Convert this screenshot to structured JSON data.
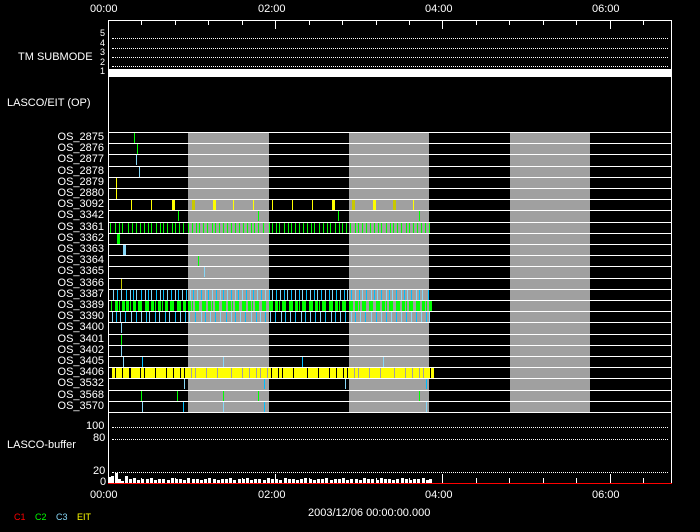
{
  "chart_data": {
    "type": "timeline",
    "date_label": "2003/12/06 00:00:00.000",
    "x_axis": {
      "unit": "hours",
      "range": [
        0,
        6.73
      ],
      "tick_labels": [
        "00:00",
        "02:00",
        "04:00",
        "06:00"
      ],
      "tick_values": [
        0,
        2,
        4,
        6
      ],
      "minor_step": 0.4
    },
    "tm_submode": {
      "label": "TM SUBMODE",
      "levels": [
        "5",
        "4",
        "3",
        "2",
        "1"
      ],
      "value": 1
    },
    "lasco_eit_label": "LASCO/EIT (OP)",
    "shaded_intervals": [
      [
        0.96,
        1.92
      ],
      [
        2.88,
        3.84
      ],
      [
        4.81,
        5.77
      ]
    ],
    "colors": {
      "C1": "#ff0000",
      "C2": "#00ff00",
      "C3": "#87d7f7",
      "CY": "#00bfff",
      "EIT": "#ffff00",
      "OL": "#c8c800"
    },
    "legend": [
      {
        "label": "C1",
        "color": "C1"
      },
      {
        "label": "C2",
        "color": "C2"
      },
      {
        "label": "C3",
        "color": "C3"
      },
      {
        "label": "EIT",
        "color": "EIT"
      }
    ],
    "rows": [
      {
        "label": "OS_2875",
        "marks": [
          {
            "c": "C2",
            "t": [
              0.31
            ]
          }
        ]
      },
      {
        "label": "OS_2876",
        "marks": [
          {
            "c": "C2",
            "t": [
              0.35
            ]
          }
        ]
      },
      {
        "label": "OS_2877",
        "marks": [
          {
            "c": "C3",
            "t": [
              0.33
            ]
          }
        ]
      },
      {
        "label": "OS_2878",
        "marks": [
          {
            "c": "C3",
            "t": [
              0.37
            ]
          }
        ]
      },
      {
        "label": "OS_2879",
        "marks": [
          {
            "c": "EIT",
            "t": [
              0.09
            ]
          }
        ]
      },
      {
        "label": "OS_2880",
        "marks": [
          {
            "c": "EIT",
            "t": [
              0.1
            ]
          }
        ]
      },
      {
        "label": "OS_3092",
        "marks": [
          {
            "c": "EIT",
            "t": [
              0.28,
              0.52,
              1.01,
              1.25,
              1.49,
              1.73,
              1.96,
              2.2,
              2.44,
              2.92,
              3.41,
              3.65
            ]
          },
          {
            "c": "EIT",
            "thick": true,
            "t": [
              0.77,
              1.25,
              2.68,
              3.17
            ]
          },
          {
            "c": "OL",
            "thick": true,
            "t": [
              1.01,
              2.92,
              3.41
            ]
          }
        ]
      },
      {
        "label": "OS_3342",
        "marks": [
          {
            "c": "C2",
            "t": [
              0.84,
              1.8,
              2.75,
              3.72
            ]
          }
        ]
      },
      {
        "label": "OS_3361",
        "marks": [
          {
            "c": "C2",
            "t": [
              0.02,
              0.08,
              0.13,
              0.17,
              0.24,
              0.29,
              0.34,
              0.38,
              0.43,
              0.48,
              0.52,
              0.57,
              0.62,
              0.66,
              0.71,
              0.76,
              0.8,
              0.85,
              0.9,
              0.96,
              1.0,
              1.05,
              1.09,
              1.14,
              1.19,
              1.24,
              1.28,
              1.33,
              1.38,
              1.42,
              1.47,
              1.52,
              1.57,
              1.61,
              1.66,
              1.71,
              1.75,
              1.8,
              1.85,
              1.92,
              1.96,
              2.01,
              2.05,
              2.1,
              2.15,
              2.19,
              2.24,
              2.29,
              2.33,
              2.38,
              2.43,
              2.47,
              2.52,
              2.57,
              2.62,
              2.66,
              2.71,
              2.76,
              2.8,
              2.85,
              2.9,
              2.95,
              2.99,
              3.04,
              3.09,
              3.13,
              3.18,
              3.23,
              3.27,
              3.32,
              3.37,
              3.41,
              3.46,
              3.51,
              3.56,
              3.6,
              3.65,
              3.7,
              3.74,
              3.79,
              3.84
            ]
          }
        ]
      },
      {
        "label": "OS_3362",
        "marks": [
          {
            "c": "C2",
            "thick": true,
            "t": [
              0.11
            ]
          }
        ]
      },
      {
        "label": "OS_3363",
        "marks": [
          {
            "c": "C3",
            "thick": true,
            "t": [
              0.18
            ]
          }
        ]
      },
      {
        "label": "OS_3364",
        "marks": [
          {
            "c": "C2",
            "t": [
              1.08
            ]
          }
        ]
      },
      {
        "label": "OS_3365",
        "marks": [
          {
            "c": "C3",
            "t": [
              1.15
            ]
          }
        ]
      },
      {
        "label": "OS_3366",
        "marks": [
          {
            "c": "OL",
            "t": [
              0.16
            ]
          }
        ]
      },
      {
        "label": "OS_3387",
        "marks": [
          {
            "c": "C3",
            "t": [
              0.06,
              0.16,
              0.26,
              0.34,
              0.44,
              0.52,
              0.62,
              0.7,
              0.8,
              0.88,
              0.98,
              1.06,
              1.16,
              1.24,
              1.34,
              1.42,
              1.52,
              1.6,
              1.7,
              1.78,
              1.88,
              1.96,
              2.06,
              2.14,
              2.24,
              2.32,
              2.42,
              2.5,
              2.6,
              2.68,
              2.78,
              2.86,
              2.96,
              3.04,
              3.14,
              3.22,
              3.32,
              3.4,
              3.5,
              3.58,
              3.68,
              3.76
            ]
          },
          {
            "c": "CY",
            "t": [
              0.11,
              0.21,
              0.3,
              0.39,
              0.48,
              0.57,
              0.66,
              0.75,
              0.84,
              0.93,
              1.02,
              1.11,
              1.2,
              1.29,
              1.38,
              1.47,
              1.56,
              1.65,
              1.74,
              1.83,
              1.92,
              2.01,
              2.1,
              2.19,
              2.28,
              2.37,
              2.46,
              2.55,
              2.64,
              2.73,
              2.82,
              2.91,
              3.0,
              3.09,
              3.18,
              3.27,
              3.36,
              3.45,
              3.54,
              3.63,
              3.72,
              3.83
            ]
          }
        ]
      },
      {
        "label": "OS_3389",
        "marks": [
          {
            "c": "C2",
            "thick": true,
            "t": [
              0.08,
              0.17,
              0.22,
              0.3,
              0.36,
              0.44,
              0.52,
              0.6,
              0.68,
              0.74,
              0.82,
              0.9,
              0.96,
              1.04,
              1.12,
              1.2,
              1.28,
              1.36,
              1.44,
              1.52,
              1.6,
              1.68,
              1.76,
              1.84,
              1.92,
              2.0,
              2.08,
              2.16,
              2.24,
              2.32,
              2.4,
              2.48,
              2.56,
              2.64,
              2.72,
              2.8,
              2.88,
              2.96,
              3.04,
              3.12,
              3.2,
              3.28,
              3.36,
              3.44,
              3.52,
              3.6,
              3.68,
              3.76,
              3.84
            ]
          },
          {
            "c": "C2",
            "t": [
              0.04,
              0.13,
              0.26,
              0.4,
              0.48,
              0.56,
              0.64,
              0.78,
              0.86,
              1.0,
              1.08,
              1.16,
              1.24,
              1.32,
              1.4,
              1.48,
              1.56,
              1.64,
              1.72,
              1.8,
              1.88,
              1.96,
              2.04,
              2.12,
              2.2,
              2.28,
              2.36,
              2.44,
              2.52,
              2.6,
              2.68,
              2.76,
              2.84,
              2.92,
              3.0,
              3.08,
              3.16,
              3.24,
              3.32,
              3.4,
              3.48,
              3.56,
              3.64,
              3.72,
              3.8
            ]
          }
        ]
      },
      {
        "label": "OS_3390",
        "marks": [
          {
            "c": "C3",
            "t": [
              0.05,
              0.14,
              0.27,
              0.4,
              0.49,
              0.61,
              0.73,
              0.86,
              0.97,
              1.11,
              1.22,
              1.34,
              1.47,
              1.58,
              1.71,
              1.82,
              1.94,
              2.07,
              2.18,
              2.31,
              2.42,
              2.54,
              2.67,
              2.78,
              2.91,
              3.02,
              3.14,
              3.27,
              3.38,
              3.51,
              3.62,
              3.74,
              3.84
            ]
          },
          {
            "c": "CY",
            "t": [
              0.09,
              0.2,
              0.33,
              0.45,
              0.56,
              0.68,
              0.8,
              0.92,
              1.04,
              1.16,
              1.28,
              1.41,
              1.52,
              1.64,
              1.77,
              1.88,
              2.0,
              2.12,
              2.24,
              2.36,
              2.48,
              2.6,
              2.72,
              2.84,
              2.96,
              3.08,
              3.2,
              3.32,
              3.44,
              3.56,
              3.68,
              3.8
            ]
          }
        ]
      },
      {
        "label": "OS_3400",
        "marks": [
          {
            "c": "C3",
            "t": [
              0.15
            ]
          }
        ]
      },
      {
        "label": "OS_3401",
        "marks": [
          {
            "c": "C2",
            "t": [
              0.15
            ]
          }
        ]
      },
      {
        "label": "OS_3402",
        "marks": [
          {
            "c": "C3",
            "t": [
              0.15
            ]
          }
        ]
      },
      {
        "label": "OS_3405",
        "marks": [
          {
            "c": "C3",
            "t": [
              0.18,
              1.37,
              3.29
            ]
          },
          {
            "c": "CY",
            "t": [
              0.41,
              2.32
            ]
          }
        ]
      },
      {
        "label": "OS_3406",
        "marks": [
          {
            "c": "EIT",
            "thick": true,
            "t": [
              0.05,
              0.09,
              0.13,
              0.18,
              0.22,
              0.27,
              0.31,
              0.35,
              0.4,
              0.44,
              0.48,
              0.52,
              0.57,
              0.61,
              0.65,
              0.7,
              0.74,
              0.79,
              0.83,
              0.87,
              0.92,
              0.96,
              1.0,
              1.05,
              1.09,
              1.13,
              1.18,
              1.22,
              1.26,
              1.31,
              1.35,
              1.39,
              1.44,
              1.48,
              1.52,
              1.57,
              1.61,
              1.65,
              1.7,
              1.74,
              1.78,
              1.83,
              1.87,
              1.91,
              1.96,
              2.0,
              2.04,
              2.09,
              2.13,
              2.17,
              2.22,
              2.26,
              2.3,
              2.35,
              2.39,
              2.43,
              2.48,
              2.52,
              2.56,
              2.61,
              2.65,
              2.69,
              2.74,
              2.78,
              2.82,
              2.87,
              2.91,
              2.95,
              3.0,
              3.04,
              3.08,
              3.13,
              3.17,
              3.21,
              3.26,
              3.3,
              3.34,
              3.39,
              3.43,
              3.47,
              3.52,
              3.56,
              3.6,
              3.65,
              3.69,
              3.73,
              3.78,
              3.82,
              3.86
            ]
          },
          {
            "c": "EIT",
            "t": [
              0.07,
              0.11,
              0.16,
              0.2,
              0.24,
              0.29,
              0.33,
              0.37,
              0.42,
              0.46,
              0.5,
              0.55,
              0.59,
              0.63,
              0.68,
              0.72,
              0.76,
              0.81,
              0.85,
              0.89,
              0.94,
              0.98,
              1.03,
              1.07,
              1.11,
              1.16,
              1.2,
              1.24,
              1.29,
              1.33,
              1.37,
              1.42,
              1.46,
              1.5,
              1.55,
              1.59,
              1.63,
              1.68,
              1.72,
              1.76,
              1.81,
              1.85,
              1.89,
              1.94,
              1.98,
              2.02,
              2.07,
              2.11,
              2.15,
              2.2,
              2.24,
              2.28,
              2.33,
              2.37,
              2.41,
              2.46,
              2.5,
              2.54,
              2.59,
              2.63,
              2.67,
              2.72,
              2.76,
              2.8,
              2.85,
              2.89,
              2.93,
              2.98,
              3.02,
              3.06,
              3.11,
              3.15,
              3.19,
              3.24,
              3.28,
              3.32,
              3.37,
              3.41,
              3.45,
              3.5,
              3.54,
              3.58,
              3.63,
              3.67,
              3.71,
              3.76,
              3.8,
              3.84
            ]
          }
        ]
      },
      {
        "label": "OS_3532",
        "marks": [
          {
            "c": "C3",
            "t": [
              0.91,
              2.84
            ]
          },
          {
            "c": "CY",
            "t": [
              1.87,
              3.8
            ]
          }
        ]
      },
      {
        "label": "OS_3568",
        "marks": [
          {
            "c": "C2",
            "t": [
              0.4,
              0.83,
              1.37,
              1.8,
              3.72
            ]
          }
        ]
      },
      {
        "label": "OS_3570",
        "marks": [
          {
            "c": "C3",
            "t": [
              0.41,
              1.37,
              3.8
            ]
          },
          {
            "c": "CY",
            "t": [
              0.9,
              1.87
            ]
          }
        ]
      }
    ],
    "buffer": {
      "label": "LASCO-buffer",
      "y_tick_labels": [
        "100",
        "80",
        "20",
        "0"
      ],
      "y_tick_values": [
        100,
        80,
        20,
        0
      ],
      "ylim": [
        0,
        100
      ],
      "t": [
        0.0,
        0.04,
        0.08,
        0.12,
        0.16,
        0.2,
        0.25,
        0.3,
        0.35,
        0.4,
        0.45,
        0.5,
        0.55,
        0.6,
        0.65,
        0.7,
        0.75,
        0.8,
        0.85,
        0.9,
        0.95,
        1.0,
        1.05,
        1.1,
        1.15,
        1.2,
        1.25,
        1.3,
        1.35,
        1.4,
        1.45,
        1.5,
        1.55,
        1.6,
        1.65,
        1.7,
        1.75,
        1.8,
        1.85,
        1.9,
        1.95,
        2.0,
        2.05,
        2.1,
        2.15,
        2.2,
        2.25,
        2.3,
        2.35,
        2.4,
        2.45,
        2.5,
        2.55,
        2.6,
        2.65,
        2.7,
        2.75,
        2.8,
        2.85,
        2.9,
        2.95,
        3.0,
        3.05,
        3.1,
        3.15,
        3.2,
        3.25,
        3.3,
        3.35,
        3.4,
        3.45,
        3.5,
        3.55,
        3.6,
        3.65,
        3.7,
        3.75,
        3.8,
        3.84
      ],
      "values": [
        10,
        12,
        18,
        8,
        3,
        13,
        7,
        9,
        6,
        8,
        7,
        9,
        6,
        8,
        7,
        6,
        9,
        7,
        8,
        6,
        9,
        7,
        8,
        6,
        7,
        9,
        8,
        6,
        7,
        8,
        9,
        6,
        8,
        7,
        9,
        6,
        8,
        7,
        6,
        9,
        7,
        8,
        6,
        9,
        7,
        8,
        6,
        7,
        9,
        8,
        6,
        7,
        8,
        9,
        6,
        8,
        7,
        9,
        6,
        8,
        7,
        6,
        9,
        7,
        8,
        6,
        9,
        7,
        8,
        6,
        7,
        9,
        8,
        6,
        7,
        8,
        9,
        6,
        8
      ]
    }
  }
}
